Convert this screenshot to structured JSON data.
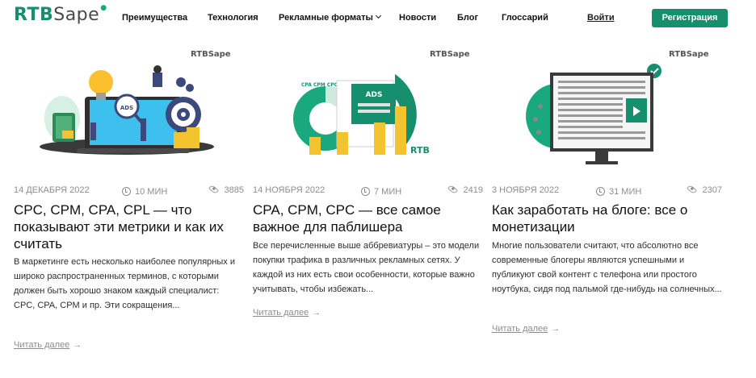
{
  "header": {
    "logo": {
      "part1": "RTB",
      "part2": "Sape"
    },
    "nav": [
      {
        "label": "Преимущества"
      },
      {
        "label": "Технология"
      },
      {
        "label": "Рекламные форматы"
      },
      {
        "label": "Новости"
      },
      {
        "label": "Блог"
      },
      {
        "label": "Глоссарий"
      }
    ],
    "login": "Войти",
    "register": "Регистрация"
  },
  "brand": {
    "accent": "#168f6e",
    "text_muted": "#8d8d8d"
  },
  "cards": [
    {
      "image": {
        "logo": "RTBSape",
        "text": "ADS"
      },
      "date": "14 декабря 2022",
      "read_time": "10 МИН",
      "views": "3885",
      "title": "CPC, CPM, CPA, CPL — что показывают эти метрики и как их считать",
      "description": "В маркетинге есть несколько наиболее популярных и широко распространенных терминов, с которыми должен быть хорошо знаком каждый специалист: CPC, CPA, CPM и пр. Эти сокращения...",
      "read_more": "Читать далее"
    },
    {
      "image": {
        "logo": "RTBSape",
        "text": "ADS",
        "brand": "RTB",
        "arc_labels": "CPA CPM CPC CPT"
      },
      "date": "14 ноября 2022",
      "read_time": "7 МИН",
      "views": "2419",
      "title": "CPA, CPM, CPC — все самое важное для паблишера",
      "description": "Все перечисленные выше аббревиатуры – это модели покупки трафика в различных рекламных сетях. У каждой из них есть свои особенности, которые важно учитывать, чтобы избежать...",
      "read_more": "Читать далее"
    },
    {
      "image": {
        "logo": "RTBSape"
      },
      "date": "3 ноября 2022",
      "read_time": "31 МИН",
      "views": "2307",
      "title": "Как заработать на блоге: все о монетизации",
      "description": "Многие пользователи считают, что абсолютно все современные блогеры являются успешными и публикуют свой контент с телефона или простого ноутбука, сидя под пальмой где-нибудь на солнечных...",
      "read_more": "Читать далее"
    }
  ]
}
